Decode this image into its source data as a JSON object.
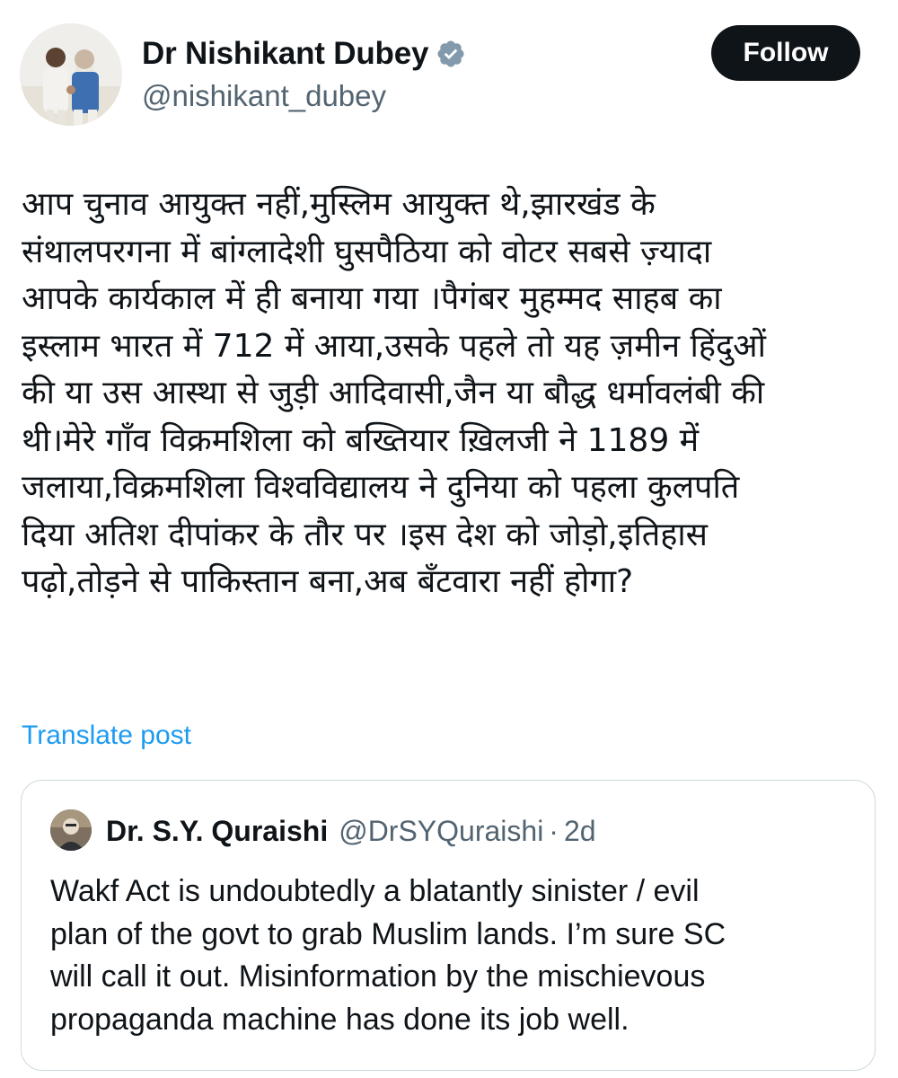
{
  "author": {
    "display_name": "Dr Nishikant Dubey",
    "handle": "@nishikant_dubey",
    "verified_icon": "verified-badge-icon"
  },
  "follow_label": "Follow",
  "post": {
    "text": "आप चुनाव आयुक्त नहीं,मुस्लिम आयुक्त थे,झारखंड के\nसंथालपरगना में बांग्लादेशी घुसपैठिया को वोटर सबसे ज़्यादा\nआपके कार्यकाल में ही बनाया गया ।पैगंबर मुहम्मद साहब  का\nइस्लाम भारत में 712 में आया,उसके पहले तो यह ज़मीन हिंदुओं\nकी या उस आस्था से जुड़ी आदिवासी,जैन या बौद्ध धर्मावलंबी की\nथी।मेरे गाँव विक्रमशिला को बख्तियार ख़िलजी ने 1189 में\nजलाया,विक्रमशिला विश्वविद्यालय ने दुनिया को पहला कुलपति\nदिया अतिश दीपांकर के तौर पर ।इस देश को जोड़ो,इतिहास\nपढ़ो,तोड़ने से पाकिस्तान बना,अब बँटवारा नहीं होगा?",
    "translate_label": "Translate post"
  },
  "quote": {
    "display_name": "Dr. S.Y. Quraishi",
    "handle": "@DrSYQuraishi",
    "separator": "·",
    "time": "2d",
    "text": "Wakf Act is undoubtedly a blatantly sinister / evil\nplan of the govt to grab Muslim lands. I’m sure SC\nwill call it out. Misinformation by the mischievous\npropaganda machine has done its job well."
  },
  "colors": {
    "text": "#0f1419",
    "secondary": "#536471",
    "link": "#1d9bf0",
    "verified": "#829aab",
    "button_bg": "#0f1419",
    "border": "#cfd9de"
  }
}
